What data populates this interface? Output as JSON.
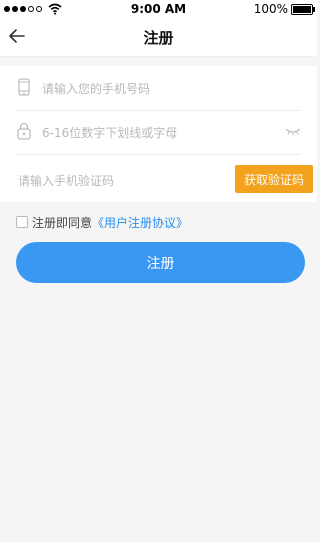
{
  "status_bar": {
    "time": "9:00 AM",
    "battery": "100%"
  },
  "nav": {
    "title": "注册"
  },
  "form": {
    "phone_placeholder": "请输入您的手机号码",
    "password_placeholder": "6-16位数字下划线或字母",
    "code_placeholder": "请输入手机验证码",
    "get_code_label": "获取验证码"
  },
  "agreement": {
    "prefix": "注册即同意",
    "link": "《用户注册协议》"
  },
  "submit_label": "注册",
  "colors": {
    "primary": "#3a97f2",
    "accent": "#f3a21d",
    "link": "#2a8ff0"
  },
  "icons": [
    "back-arrow-icon",
    "phone-icon",
    "lock-icon",
    "eye-closed-icon",
    "wifi-icon",
    "battery-icon"
  ]
}
